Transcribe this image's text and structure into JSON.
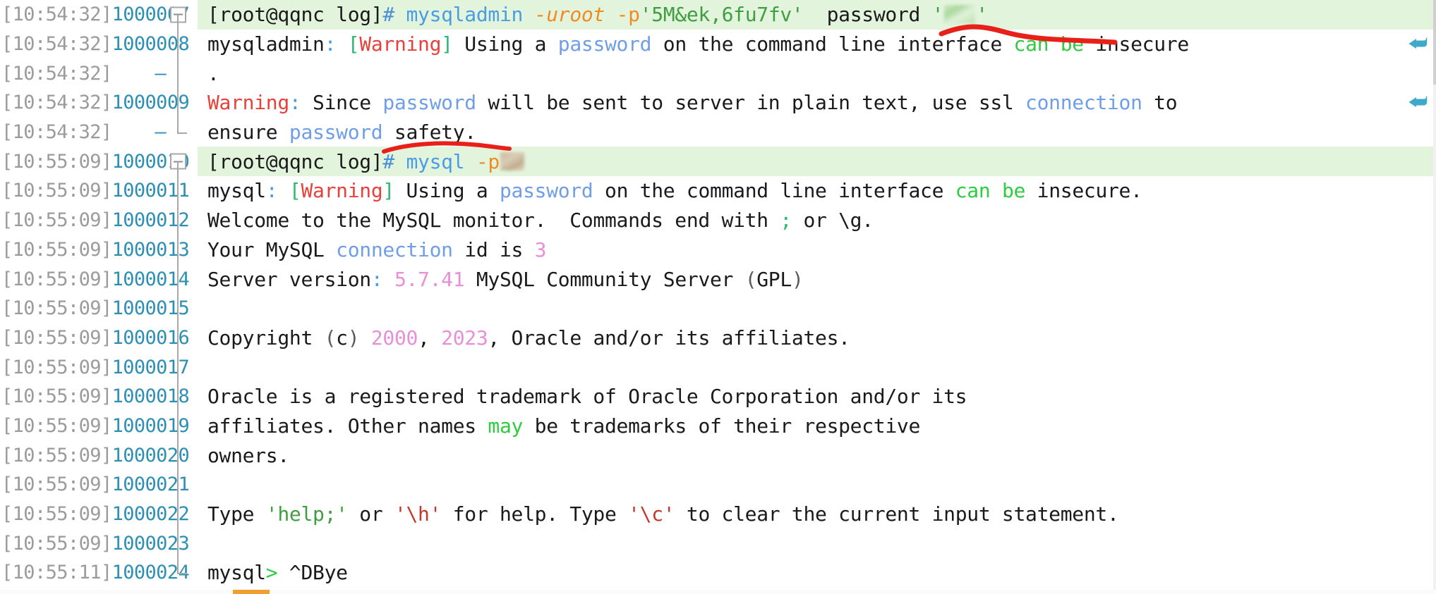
{
  "app": {
    "type": "terminal-session-log-viewer",
    "line_height_px": 41.7,
    "colors": {
      "command_row_background": "#e3f4dd",
      "line_number": "#2e8fb5",
      "timestamp": "#9b9b9b",
      "annotation_red": "#e8201a",
      "keyword_blue": "#6f9ee8",
      "string_green": "#3f9e3f",
      "option_orange": "#f08a24",
      "warning_red": "#e8413c",
      "number_pink": "#e88fd8",
      "wrap_marker_teal": "#3fa9c9"
    }
  },
  "annotations": [
    {
      "name": "red-underline-password",
      "target": "password '█'",
      "row_index": 0
    },
    {
      "name": "red-underline-mysql-p",
      "target": "mysql -p█",
      "row_index": 6
    }
  ],
  "rows": [
    {
      "timestamp": "[10:54:32]",
      "lineno": "1000007",
      "fold": "collapse-box",
      "tree": "start",
      "command": true,
      "wrap": false,
      "segments": [
        {
          "text": "[root@qqnc log]",
          "cls": "c-prompt"
        },
        {
          "text": "#",
          "cls": "c-hash"
        },
        {
          "text": " ",
          "cls": "c-prompt"
        },
        {
          "text": "mysqladmin",
          "cls": "c-cmd"
        },
        {
          "text": " ",
          "cls": "c-prompt"
        },
        {
          "text": "-uroot",
          "cls": "c-opt"
        },
        {
          "text": " ",
          "cls": "c-prompt"
        },
        {
          "text": "-p",
          "cls": "c-opt2"
        },
        {
          "text": "'5M&ek,6fu7fv'",
          "cls": "c-str"
        },
        {
          "text": "  password ",
          "cls": "c-prompt"
        },
        {
          "text": "'",
          "cls": "c-str"
        },
        {
          "text": "",
          "cls": "blur-block"
        },
        {
          "text": "'",
          "cls": "c-str"
        }
      ]
    },
    {
      "timestamp": "[10:54:32]",
      "lineno": "1000008",
      "fold": "none",
      "tree": "line",
      "command": false,
      "wrap": true,
      "segments": [
        {
          "text": "mysqladmin",
          "cls": "c-prompt"
        },
        {
          "text": ":",
          "cls": "c-colon"
        },
        {
          "text": " ",
          "cls": "c-prompt"
        },
        {
          "text": "[",
          "cls": "c-brk"
        },
        {
          "text": "Warning",
          "cls": "c-warn"
        },
        {
          "text": "]",
          "cls": "c-brk"
        },
        {
          "text": " Using a ",
          "cls": "c-prompt"
        },
        {
          "text": "password",
          "cls": "c-kw"
        },
        {
          "text": " on the command line interface ",
          "cls": "c-prompt"
        },
        {
          "text": "can be",
          "cls": "c-green"
        },
        {
          "text": " insecure",
          "cls": "c-prompt"
        }
      ]
    },
    {
      "timestamp": "[10:54:32]",
      "lineno": "–",
      "fold": "none",
      "tree": "line",
      "command": false,
      "wrap": false,
      "segments": [
        {
          "text": ".",
          "cls": "c-prompt"
        }
      ]
    },
    {
      "timestamp": "[10:54:32]",
      "lineno": "1000009",
      "fold": "none",
      "tree": "line",
      "command": false,
      "wrap": true,
      "segments": [
        {
          "text": "Warning",
          "cls": "c-warn"
        },
        {
          "text": ":",
          "cls": "c-colon"
        },
        {
          "text": " Since ",
          "cls": "c-prompt"
        },
        {
          "text": "password",
          "cls": "c-kw"
        },
        {
          "text": " will be sent to server in plain text, use ssl ",
          "cls": "c-prompt"
        },
        {
          "text": "connection",
          "cls": "c-kw"
        },
        {
          "text": " to",
          "cls": "c-prompt"
        }
      ]
    },
    {
      "timestamp": "[10:54:32]",
      "lineno": "–",
      "fold": "none",
      "tree": "end",
      "command": false,
      "wrap": false,
      "segments": [
        {
          "text": "ensure ",
          "cls": "c-prompt"
        },
        {
          "text": "password",
          "cls": "c-kw"
        },
        {
          "text": " safety.",
          "cls": "c-prompt"
        }
      ]
    },
    {
      "timestamp": "[10:55:09]",
      "lineno": "1000010",
      "fold": "collapse-box",
      "tree": "start",
      "command": true,
      "wrap": false,
      "segments": [
        {
          "text": "[root@qqnc log]",
          "cls": "c-prompt"
        },
        {
          "text": "#",
          "cls": "c-hash"
        },
        {
          "text": " ",
          "cls": "c-prompt"
        },
        {
          "text": "mysql",
          "cls": "c-cmd"
        },
        {
          "text": " ",
          "cls": "c-prompt"
        },
        {
          "text": "-p",
          "cls": "c-opt2"
        },
        {
          "text": "",
          "cls": "blur-block-dark"
        }
      ]
    },
    {
      "timestamp": "[10:55:09]",
      "lineno": "1000011",
      "fold": "none",
      "tree": "line",
      "command": false,
      "wrap": false,
      "segments": [
        {
          "text": "mysql",
          "cls": "c-prompt"
        },
        {
          "text": ":",
          "cls": "c-colon"
        },
        {
          "text": " ",
          "cls": "c-prompt"
        },
        {
          "text": "[",
          "cls": "c-brk"
        },
        {
          "text": "Warning",
          "cls": "c-warn"
        },
        {
          "text": "]",
          "cls": "c-brk"
        },
        {
          "text": " Using a ",
          "cls": "c-prompt"
        },
        {
          "text": "password",
          "cls": "c-kw"
        },
        {
          "text": " on the command line interface ",
          "cls": "c-prompt"
        },
        {
          "text": "can be",
          "cls": "c-green"
        },
        {
          "text": " insecure.",
          "cls": "c-prompt"
        }
      ]
    },
    {
      "timestamp": "[10:55:09]",
      "lineno": "1000012",
      "fold": "none",
      "tree": "line",
      "command": false,
      "wrap": false,
      "segments": [
        {
          "text": "Welcome to the MySQL monitor.  Commands end with ",
          "cls": "c-prompt"
        },
        {
          "text": ";",
          "cls": "c-semi"
        },
        {
          "text": " or \\g.",
          "cls": "c-prompt"
        }
      ]
    },
    {
      "timestamp": "[10:55:09]",
      "lineno": "1000013",
      "fold": "none",
      "tree": "line",
      "command": false,
      "wrap": false,
      "segments": [
        {
          "text": "Your MySQL ",
          "cls": "c-prompt"
        },
        {
          "text": "connection",
          "cls": "c-kw"
        },
        {
          "text": " id is ",
          "cls": "c-prompt"
        },
        {
          "text": "3",
          "cls": "c-num"
        }
      ]
    },
    {
      "timestamp": "[10:55:09]",
      "lineno": "1000014",
      "fold": "none",
      "tree": "line",
      "command": false,
      "wrap": false,
      "segments": [
        {
          "text": "Server version",
          "cls": "c-prompt"
        },
        {
          "text": ":",
          "cls": "c-colon"
        },
        {
          "text": " ",
          "cls": "c-prompt"
        },
        {
          "text": "5.7.41",
          "cls": "c-num"
        },
        {
          "text": " MySQL Community Server ",
          "cls": "c-prompt"
        },
        {
          "text": "(",
          "cls": "c-paren"
        },
        {
          "text": "GPL",
          "cls": "c-prompt"
        },
        {
          "text": ")",
          "cls": "c-paren"
        }
      ]
    },
    {
      "timestamp": "[10:55:09]",
      "lineno": "1000015",
      "fold": "none",
      "tree": "line",
      "command": false,
      "wrap": false,
      "segments": []
    },
    {
      "timestamp": "[10:55:09]",
      "lineno": "1000016",
      "fold": "none",
      "tree": "line",
      "command": false,
      "wrap": false,
      "segments": [
        {
          "text": "Copyright ",
          "cls": "c-prompt"
        },
        {
          "text": "(",
          "cls": "c-paren"
        },
        {
          "text": "c",
          "cls": "c-prompt"
        },
        {
          "text": ")",
          "cls": "c-paren"
        },
        {
          "text": " ",
          "cls": "c-prompt"
        },
        {
          "text": "2000",
          "cls": "c-num"
        },
        {
          "text": ", ",
          "cls": "c-prompt"
        },
        {
          "text": "2023",
          "cls": "c-num"
        },
        {
          "text": ", Oracle and/or its affiliates.",
          "cls": "c-prompt"
        }
      ]
    },
    {
      "timestamp": "[10:55:09]",
      "lineno": "1000017",
      "fold": "none",
      "tree": "line",
      "command": false,
      "wrap": false,
      "segments": []
    },
    {
      "timestamp": "[10:55:09]",
      "lineno": "1000018",
      "fold": "none",
      "tree": "line",
      "command": false,
      "wrap": false,
      "segments": [
        {
          "text": "Oracle is a registered trademark of Oracle Corporation and/or its",
          "cls": "c-prompt"
        }
      ]
    },
    {
      "timestamp": "[10:55:09]",
      "lineno": "1000019",
      "fold": "none",
      "tree": "line",
      "command": false,
      "wrap": false,
      "segments": [
        {
          "text": "affiliates. Other names ",
          "cls": "c-prompt"
        },
        {
          "text": "may",
          "cls": "c-green"
        },
        {
          "text": " be trademarks of their respective",
          "cls": "c-prompt"
        }
      ]
    },
    {
      "timestamp": "[10:55:09]",
      "lineno": "1000020",
      "fold": "none",
      "tree": "line",
      "command": false,
      "wrap": false,
      "segments": [
        {
          "text": "owners.",
          "cls": "c-prompt"
        }
      ]
    },
    {
      "timestamp": "[10:55:09]",
      "lineno": "1000021",
      "fold": "none",
      "tree": "line",
      "command": false,
      "wrap": false,
      "segments": []
    },
    {
      "timestamp": "[10:55:09]",
      "lineno": "1000022",
      "fold": "none",
      "tree": "line",
      "command": false,
      "wrap": false,
      "segments": [
        {
          "text": "Type ",
          "cls": "c-prompt"
        },
        {
          "text": "'help;'",
          "cls": "c-str"
        },
        {
          "text": " or ",
          "cls": "c-prompt"
        },
        {
          "text": "'\\h'",
          "cls": "c-esc"
        },
        {
          "text": " for help. Type ",
          "cls": "c-prompt"
        },
        {
          "text": "'\\c'",
          "cls": "c-esc"
        },
        {
          "text": " to clear the current input statement.",
          "cls": "c-prompt"
        }
      ]
    },
    {
      "timestamp": "[10:55:09]",
      "lineno": "1000023",
      "fold": "none",
      "tree": "line",
      "command": false,
      "wrap": false,
      "segments": []
    },
    {
      "timestamp": "[10:55:11]",
      "lineno": "1000024",
      "fold": "none",
      "tree": "end",
      "command": false,
      "wrap": false,
      "segments": [
        {
          "text": "mysql",
          "cls": "c-prompt"
        },
        {
          "text": ">",
          "cls": "c-gt"
        },
        {
          "text": " ^DBye",
          "cls": "c-prompt"
        }
      ]
    }
  ]
}
